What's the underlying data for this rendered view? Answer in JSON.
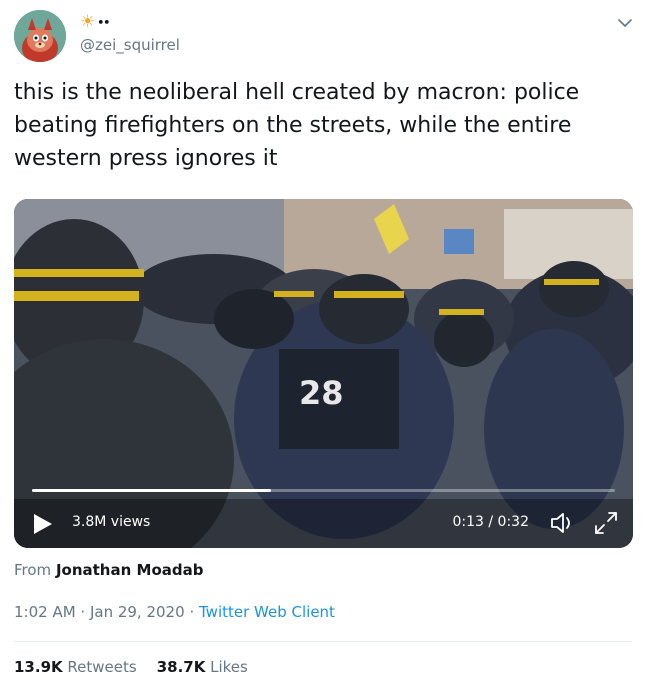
{
  "author": {
    "display_name_emoji": "☀",
    "display_name_extra": "••",
    "handle": "@zei_squirrel",
    "avatar_icon": "cartoon-animal-avatar"
  },
  "tweet": {
    "text": "this is the neoliberal hell created by macron: police beating firefighters on the streets, while the entire western press ignores it"
  },
  "video": {
    "views": "3.8M views",
    "time": "0:13 / 0:32",
    "progress": 0.41
  },
  "source": {
    "prefix": "From",
    "name": "Jonathan Moadab"
  },
  "meta": {
    "timestamp": "1:02 AM · Jan 29, 2020",
    "separator": "·",
    "client": "Twitter Web Client"
  },
  "stats": {
    "retweets_count": "13.9K",
    "retweets_label": "Retweets",
    "likes_count": "38.7K",
    "likes_label": "Likes"
  },
  "colors": {
    "link": "#1b95e0",
    "muted": "#657786",
    "text": "#14171a"
  }
}
